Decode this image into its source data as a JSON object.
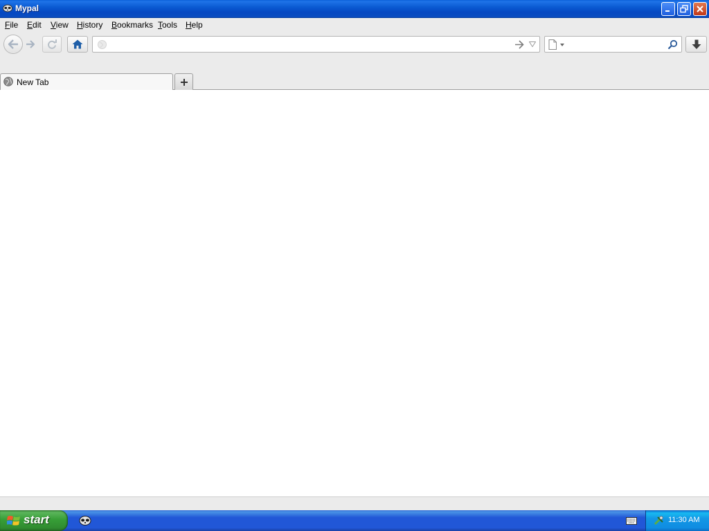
{
  "window": {
    "title": "Mypal",
    "icon": "mypal-raccoon-icon"
  },
  "menubar": {
    "items": [
      {
        "label": "File",
        "accesskey": "F"
      },
      {
        "label": "Edit",
        "accesskey": "E"
      },
      {
        "label": "View",
        "accesskey": "V"
      },
      {
        "label": "History",
        "accesskey": "H"
      },
      {
        "label": "Bookmarks",
        "accesskey": "B"
      },
      {
        "label": "Tools",
        "accesskey": "T"
      },
      {
        "label": "Help",
        "accesskey": "H"
      }
    ]
  },
  "navbar": {
    "url_value": "",
    "url_placeholder": "",
    "search_value": "",
    "search_placeholder": ""
  },
  "tabs": [
    {
      "label": "New Tab",
      "active": true
    }
  ],
  "taskbar": {
    "start_label": "start",
    "clock": "11:30 AM"
  },
  "colors": {
    "titlebar": "#0b5bd3",
    "chrome": "#ebebeb",
    "taskbar": "#2157d7",
    "start_green": "#379e37",
    "home_blue": "#1f5fa8"
  }
}
